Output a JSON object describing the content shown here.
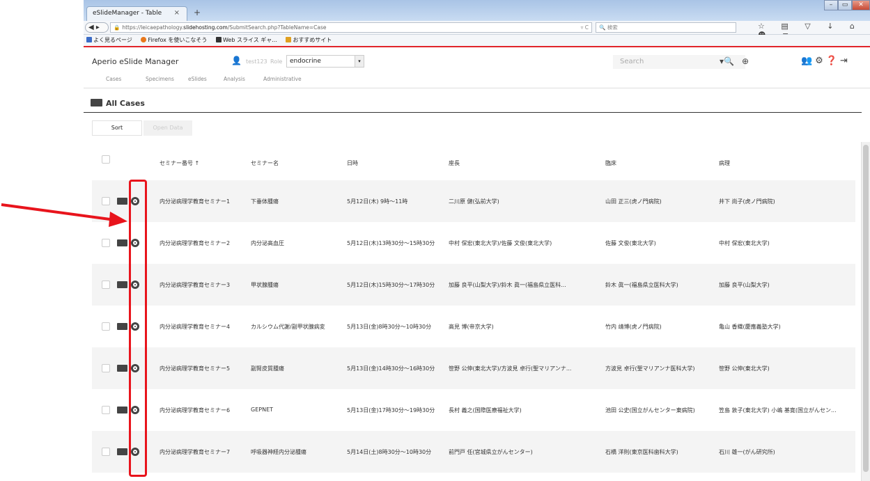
{
  "browser": {
    "tab_title": "eSlideManager - Table",
    "tab_close": "×",
    "new_tab": "+",
    "url_prefix": "https://leicaepathology.",
    "url_host": "slidehosting.com",
    "url_path": "/SubmitSearch.php?TableName=Case",
    "search_placeholder": "検索",
    "bookmarks": [
      "よく見るページ",
      "Firefox を使いこなそう",
      "Web スライス ギャ...",
      "おすすめサイト"
    ]
  },
  "app": {
    "brand": "Aperio eSlide Manager",
    "username": "test123",
    "role_label": "Role",
    "role_value": "endocrine",
    "search_placeholder": "Search",
    "menu": [
      "Cases",
      "Specimens",
      "eSlides",
      "Analysis",
      "Administrative"
    ]
  },
  "page": {
    "title": "All Cases",
    "sort_label": "Sort",
    "open_data_label": "Open Data"
  },
  "table": {
    "columns": [
      "セミナー番号 ↑",
      "セミナー名",
      "日時",
      "座長",
      "臨床",
      "病理"
    ],
    "rows": [
      [
        "内分泌病理学教育セミナー1",
        "下垂体腫瘍",
        "5月12日(木) 9時～11時",
        "二川原 健(弘前大学)",
        "山田 正三(虎ノ門病院)",
        "井下 尚子(虎ノ門病院)"
      ],
      [
        "内分泌病理学教育セミナー2",
        "内分泌高血圧",
        "5月12日(木)13時30分～15時30分",
        "中村 保宏(東北大学)/佐藤 文俊(東北大学)",
        "佐藤 文俊(東北大学)",
        "中村 保宏(東北大学)"
      ],
      [
        "内分泌病理学教育セミナー3",
        "甲状腺腫瘍",
        "5月12日(木)15時30分～17時30分",
        "加藤 良平(山梨大学)/鈴木 眞一(福島県立医科...",
        "鈴木 眞一(福島県立医科大学)",
        "加藤 良平(山梨大学)"
      ],
      [
        "内分泌病理学教育セミナー4",
        "カルシウム代謝/副甲状腺病変",
        "5月13日(金)8時30分～10時30分",
        "高見 博(帝京大学)",
        "竹内 靖博(虎ノ門病院)",
        "亀山 香織(慶應義塾大学)"
      ],
      [
        "内分泌病理学教育セミナー5",
        "副腎皮質腫瘍",
        "5月13日(金)14時30分～16時30分",
        "笹野 公伸(東北大学)/方波見 卓行(聖マリアンナ...",
        "方波見 卓行(聖マリアンナ医科大学)",
        "笹野 公伸(東北大学)"
      ],
      [
        "内分泌病理学教育セミナー6",
        "GEPNET",
        "5月13日(金)17時30分～19時30分",
        "長村 義之(国際医療福祉大学)",
        "池田 公史(国立がんセンター東病院)",
        "笠島 敦子(東北大学) 小嶋 基寛(国立がんセン..."
      ],
      [
        "内分泌病理学教育セミナー7",
        "呼吸器神経内分泌腫瘍",
        "5月14日(土)8時30分～10時30分",
        "前門戸 任(宮城県立がんセンター)",
        "石橋 洋則(東京医科歯科大学)",
        "石川 雄一(がん研究所)"
      ]
    ]
  },
  "annotation": {
    "color": "#e8141c"
  }
}
